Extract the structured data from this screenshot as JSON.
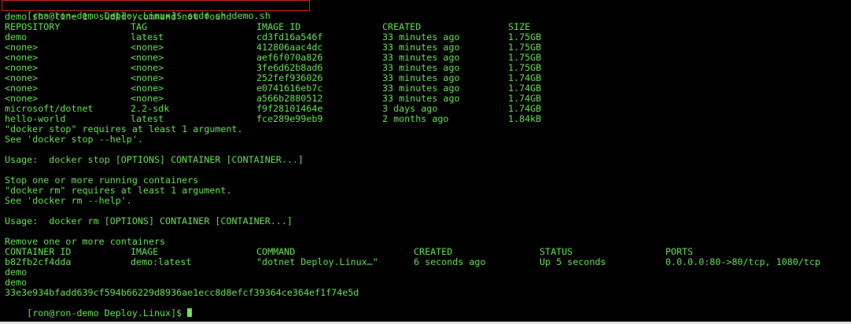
{
  "first_command": {
    "prompt": "[ron@ron-demo Deploy.Linux]$",
    "command": "sudo sh demo.sh"
  },
  "error_line": "demo.sh: line 1: sudld: command not found",
  "images_table": {
    "headers": [
      "REPOSITORY",
      "TAG",
      "IMAGE ID",
      "CREATED",
      "SIZE"
    ],
    "rows": [
      [
        "demo",
        "latest",
        "cd3fd16a546f",
        "33 minutes ago",
        "1.75GB"
      ],
      [
        "<none>",
        "<none>",
        "412806aac4dc",
        "33 minutes ago",
        "1.75GB"
      ],
      [
        "<none>",
        "<none>",
        "aef6f070a826",
        "33 minutes ago",
        "1.75GB"
      ],
      [
        "<none>",
        "<none>",
        "3fe6d62b8ad6",
        "33 minutes ago",
        "1.75GB"
      ],
      [
        "<none>",
        "<none>",
        "252fef936026",
        "33 minutes ago",
        "1.74GB"
      ],
      [
        "<none>",
        "<none>",
        "e0741616eb7c",
        "33 minutes ago",
        "1.74GB"
      ],
      [
        "<none>",
        "<none>",
        "a566b2880512",
        "33 minutes ago",
        "1.74GB"
      ],
      [
        "microsoft/dotnet",
        "2.2-sdk",
        "f9f28101464e",
        "3 days ago",
        "1.74GB"
      ],
      [
        "hello-world",
        "latest",
        "fce289e99eb9",
        "2 months ago",
        "1.84kB"
      ]
    ]
  },
  "docker_stop_help": {
    "l1": "\"docker stop\" requires at least 1 argument.",
    "l2": "See 'docker stop --help'.",
    "l3": "Usage:  docker stop [OPTIONS] CONTAINER [CONTAINER...]",
    "l4": "Stop one or more running containers"
  },
  "docker_rm_help": {
    "l1": "\"docker rm\" requires at least 1 argument.",
    "l2": "See 'docker rm --help'.",
    "l3": "Usage:  docker rm [OPTIONS] CONTAINER [CONTAINER...]",
    "l4": "Remove one or more containers"
  },
  "containers_table": {
    "headers": [
      "CONTAINER ID",
      "IMAGE",
      "COMMAND",
      "CREATED",
      "STATUS",
      "PORTS"
    ],
    "rows": [
      [
        "b82fb2cf4dda",
        "demo:latest",
        "\"dotnet Deploy.Linux…\"",
        "6 seconds ago",
        "Up 5 seconds",
        "0.0.0.0:80->80/tcp, 1080/tcp"
      ]
    ]
  },
  "tail_lines": {
    "l1": "demo",
    "l2": "demo",
    "l3": "33e3e934bfadd639cf594b66229d8936ae1ecc8d8efcf39364ce364ef1f74e5d"
  },
  "final_prompt": "[ron@ron-demo Deploy.Linux]$",
  "colors": {
    "text": "#6ee85c",
    "background": "#000000",
    "highlight_border": "#e02020"
  }
}
